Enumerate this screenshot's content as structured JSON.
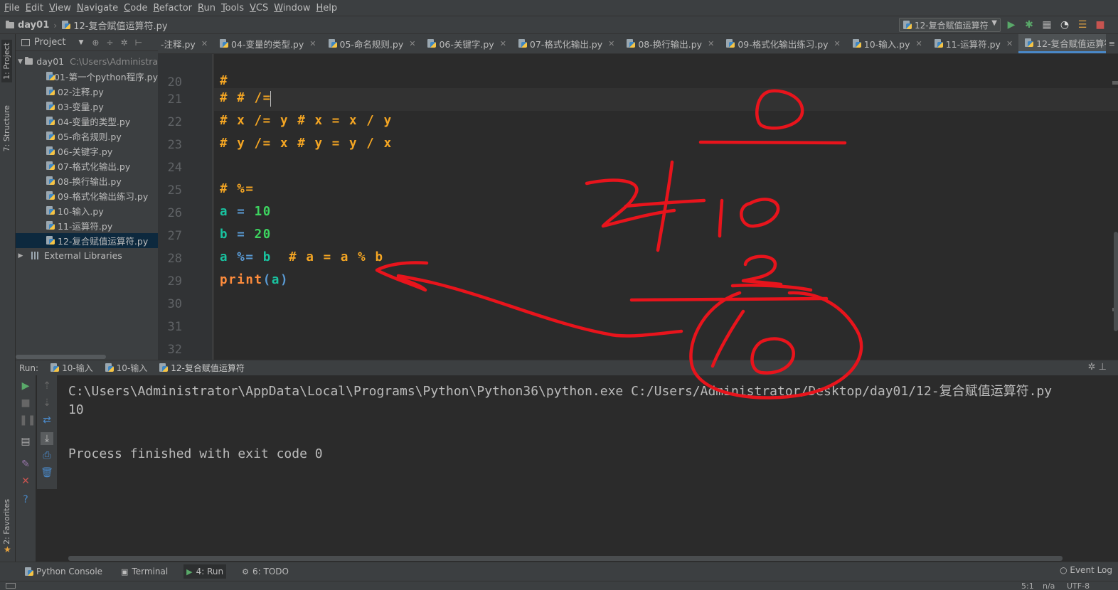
{
  "menu": [
    "File",
    "Edit",
    "View",
    "Navigate",
    "Code",
    "Refactor",
    "Run",
    "Tools",
    "VCS",
    "Window",
    "Help"
  ],
  "breadcrumb": {
    "project": "day01",
    "file": "12-复合赋值运算符.py"
  },
  "run_config": "12-复合赋值运算符",
  "left_strip": {
    "project_tab": "1: Project",
    "structure_tab": "7: Structure",
    "favorites_tab": "2: Favorites"
  },
  "project_panel": {
    "title": "Project",
    "root": {
      "name": "day01",
      "path": "C:\\Users\\Administra"
    },
    "files": [
      "01-第一个python程序.py",
      "02-注释.py",
      "03-变量.py",
      "04-变量的类型.py",
      "05-命名规则.py",
      "06-关键字.py",
      "07-格式化输出.py",
      "08-换行输出.py",
      "09-格式化输出练习.py",
      "10-输入.py",
      "11-运算符.py",
      "12-复合赋值运算符.py"
    ],
    "selected_index": 11,
    "external_libraries": "External Libraries"
  },
  "editor_tabs": [
    "-注释.py",
    "04-变量的类型.py",
    "05-命名规则.py",
    "06-关键字.py",
    "07-格式化输出.py",
    "08-换行输出.py",
    "09-格式化输出练习.py",
    "10-输入.py",
    "11-运算符.py",
    "12-复合赋值运算符.py"
  ],
  "active_tab_index": 9,
  "tab_overflow": "≡",
  "code": {
    "partial_line_no": "20",
    "partial_text": "#",
    "lines": [
      {
        "no": "21",
        "tokens": [
          {
            "t": "# # /=",
            "c": "comment"
          }
        ]
      },
      {
        "no": "22",
        "tokens": [
          {
            "t": "# x /= y # x = x / y",
            "c": "comment"
          }
        ]
      },
      {
        "no": "23",
        "tokens": [
          {
            "t": "# y /= x # y = y / x",
            "c": "comment"
          }
        ]
      },
      {
        "no": "24",
        "tokens": []
      },
      {
        "no": "25",
        "tokens": [
          {
            "t": "# %=",
            "c": "comment"
          }
        ]
      },
      {
        "no": "26",
        "tokens": [
          {
            "t": "a",
            "c": "var"
          },
          {
            "t": " = ",
            "c": "op"
          },
          {
            "t": "10",
            "c": "num"
          }
        ]
      },
      {
        "no": "27",
        "tokens": [
          {
            "t": "b",
            "c": "var"
          },
          {
            "t": " = ",
            "c": "op"
          },
          {
            "t": "20",
            "c": "num"
          }
        ]
      },
      {
        "no": "28",
        "tokens": [
          {
            "t": "a",
            "c": "var"
          },
          {
            "t": " %= ",
            "c": "op"
          },
          {
            "t": "b",
            "c": "var"
          },
          {
            "t": "  # a = a % b",
            "c": "comment"
          }
        ]
      },
      {
        "no": "29",
        "tokens": [
          {
            "t": "print",
            "c": "func"
          },
          {
            "t": "(",
            "c": "op"
          },
          {
            "t": "a",
            "c": "var"
          },
          {
            "t": ")",
            "c": "op"
          }
        ]
      },
      {
        "no": "30",
        "tokens": []
      },
      {
        "no": "31",
        "tokens": []
      },
      {
        "no": "32",
        "tokens": []
      }
    ]
  },
  "run_panel": {
    "label": "Run:",
    "tabs": [
      "10-输入",
      "10-输入",
      "12-复合赋值运算符"
    ],
    "active_tab_index": 2
  },
  "console": {
    "command": "C:\\Users\\Administrator\\AppData\\Local\\Programs\\Python\\Python36\\python.exe C:/Users/Administrator/Desktop/day01/12-复合赋值运算符.py",
    "output": "10",
    "exit": "Process finished with exit code 0"
  },
  "bottom_bar": {
    "python_console": "Python Console",
    "terminal": "Terminal",
    "run": "4: Run",
    "todo": "6: TODO",
    "event_log": "Event Log"
  },
  "status_bar": {
    "position": "5:1",
    "line_sep": "n/a",
    "encoding": "UTF-8"
  },
  "colors": {
    "accent": "#4a88c7",
    "annotation": "#e8141c",
    "comment": "#f5a623",
    "number": "#3dd35f",
    "variable": "#19c3a0"
  },
  "annotation_text": [
    "0",
    "2",
    "10",
    "0",
    "10"
  ]
}
